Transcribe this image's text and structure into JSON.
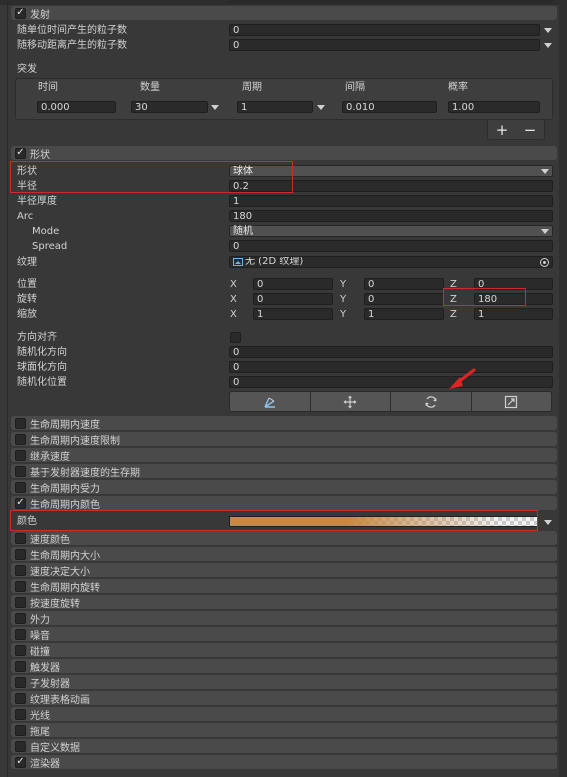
{
  "emission": {
    "header": "发射",
    "checked": true,
    "rate_over_time": {
      "label": "随单位时间产生的粒子数",
      "value": "0"
    },
    "rate_over_distance": {
      "label": "随移动距离产生的粒子数",
      "value": "0"
    },
    "bursts": {
      "label": "突发",
      "columns": [
        "时间",
        "数量",
        "周期",
        "间隔",
        "概率"
      ],
      "row": {
        "time": "0.000",
        "count": "30",
        "cycles": "1",
        "interval": "0.010",
        "probability": "1.00"
      },
      "add_label": "+",
      "remove_label": "−"
    }
  },
  "shape": {
    "header": "形状",
    "checked": true,
    "shape_type": {
      "label": "形状",
      "value": "球体"
    },
    "radius": {
      "label": "半径",
      "value": "0.2"
    },
    "radius_thickness": {
      "label": "半径厚度",
      "value": "1"
    },
    "arc": {
      "label": "Arc",
      "value": "180"
    },
    "mode": {
      "label": "Mode",
      "value": "随机"
    },
    "spread": {
      "label": "Spread",
      "value": "0"
    },
    "texture": {
      "label": "纹理",
      "value": "无 (2D 纹理)"
    },
    "position": {
      "label": "位置",
      "x": "0",
      "y": "0",
      "z": "0"
    },
    "rotation": {
      "label": "旋转",
      "x": "0",
      "y": "0",
      "z": "180"
    },
    "scale": {
      "label": "缩放",
      "x": "1",
      "y": "1",
      "z": "1"
    },
    "axis_labels": {
      "x": "X",
      "y": "Y",
      "z": "Z"
    },
    "align_to_direction": {
      "label": "方向对齐",
      "checked": false
    },
    "randomize_direction": {
      "label": "随机化方向",
      "value": "0"
    },
    "spherize_direction": {
      "label": "球面化方向",
      "value": "0"
    },
    "randomize_position": {
      "label": "随机化位置",
      "value": "0"
    },
    "tools": [
      "edit-shape-icon",
      "move-icon",
      "rotate-icon",
      "scale-icon"
    ]
  },
  "modules": [
    {
      "label": "生命周期内速度",
      "checked": false
    },
    {
      "label": "生命周期内速度限制",
      "checked": false
    },
    {
      "label": "继承速度",
      "checked": false
    },
    {
      "label": "基于发射器速度的生存期",
      "checked": false
    },
    {
      "label": "生命周期内受力",
      "checked": false
    },
    {
      "label": "生命周期内颜色",
      "checked": true
    }
  ],
  "color_over_lifetime": {
    "label": "颜色",
    "gradient_color": "#c48848"
  },
  "modules_after": [
    {
      "label": "速度颜色",
      "checked": false
    },
    {
      "label": "生命周期内大小",
      "checked": false
    },
    {
      "label": "速度决定大小",
      "checked": false
    },
    {
      "label": "生命周期内旋转",
      "checked": false
    },
    {
      "label": "按速度旋转",
      "checked": false
    },
    {
      "label": "外力",
      "checked": false
    },
    {
      "label": "噪音",
      "checked": false
    },
    {
      "label": "碰撞",
      "checked": false
    },
    {
      "label": "触发器",
      "checked": false
    },
    {
      "label": "子发射器",
      "checked": false
    },
    {
      "label": "纹理表格动画",
      "checked": false
    },
    {
      "label": "光线",
      "checked": false
    },
    {
      "label": "拖尾",
      "checked": false
    },
    {
      "label": "自定义数据",
      "checked": false
    },
    {
      "label": "渲染器",
      "checked": true
    }
  ],
  "colors": {
    "highlight": "#d12a2a",
    "accent_arrow": "#e02424"
  }
}
